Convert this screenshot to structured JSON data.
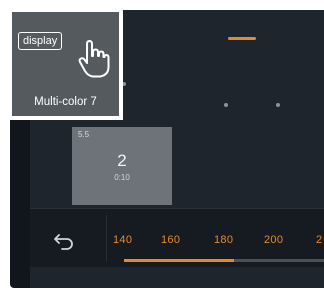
{
  "overlay": {
    "badge_label": "display",
    "caption": "Multi-color 7",
    "icon": "tap-hand-icon"
  },
  "tile": {
    "tag": "5.5",
    "number": "2",
    "subtext": "0:10"
  },
  "scale": {
    "labels": [
      "140",
      "160",
      "180",
      "200",
      "2"
    ],
    "progress_percent": 55
  },
  "icons": {
    "back": "back-arrow-icon"
  },
  "colors": {
    "accent": "#e58a2c",
    "background": "#1e252c",
    "tile": "#6d7379"
  }
}
